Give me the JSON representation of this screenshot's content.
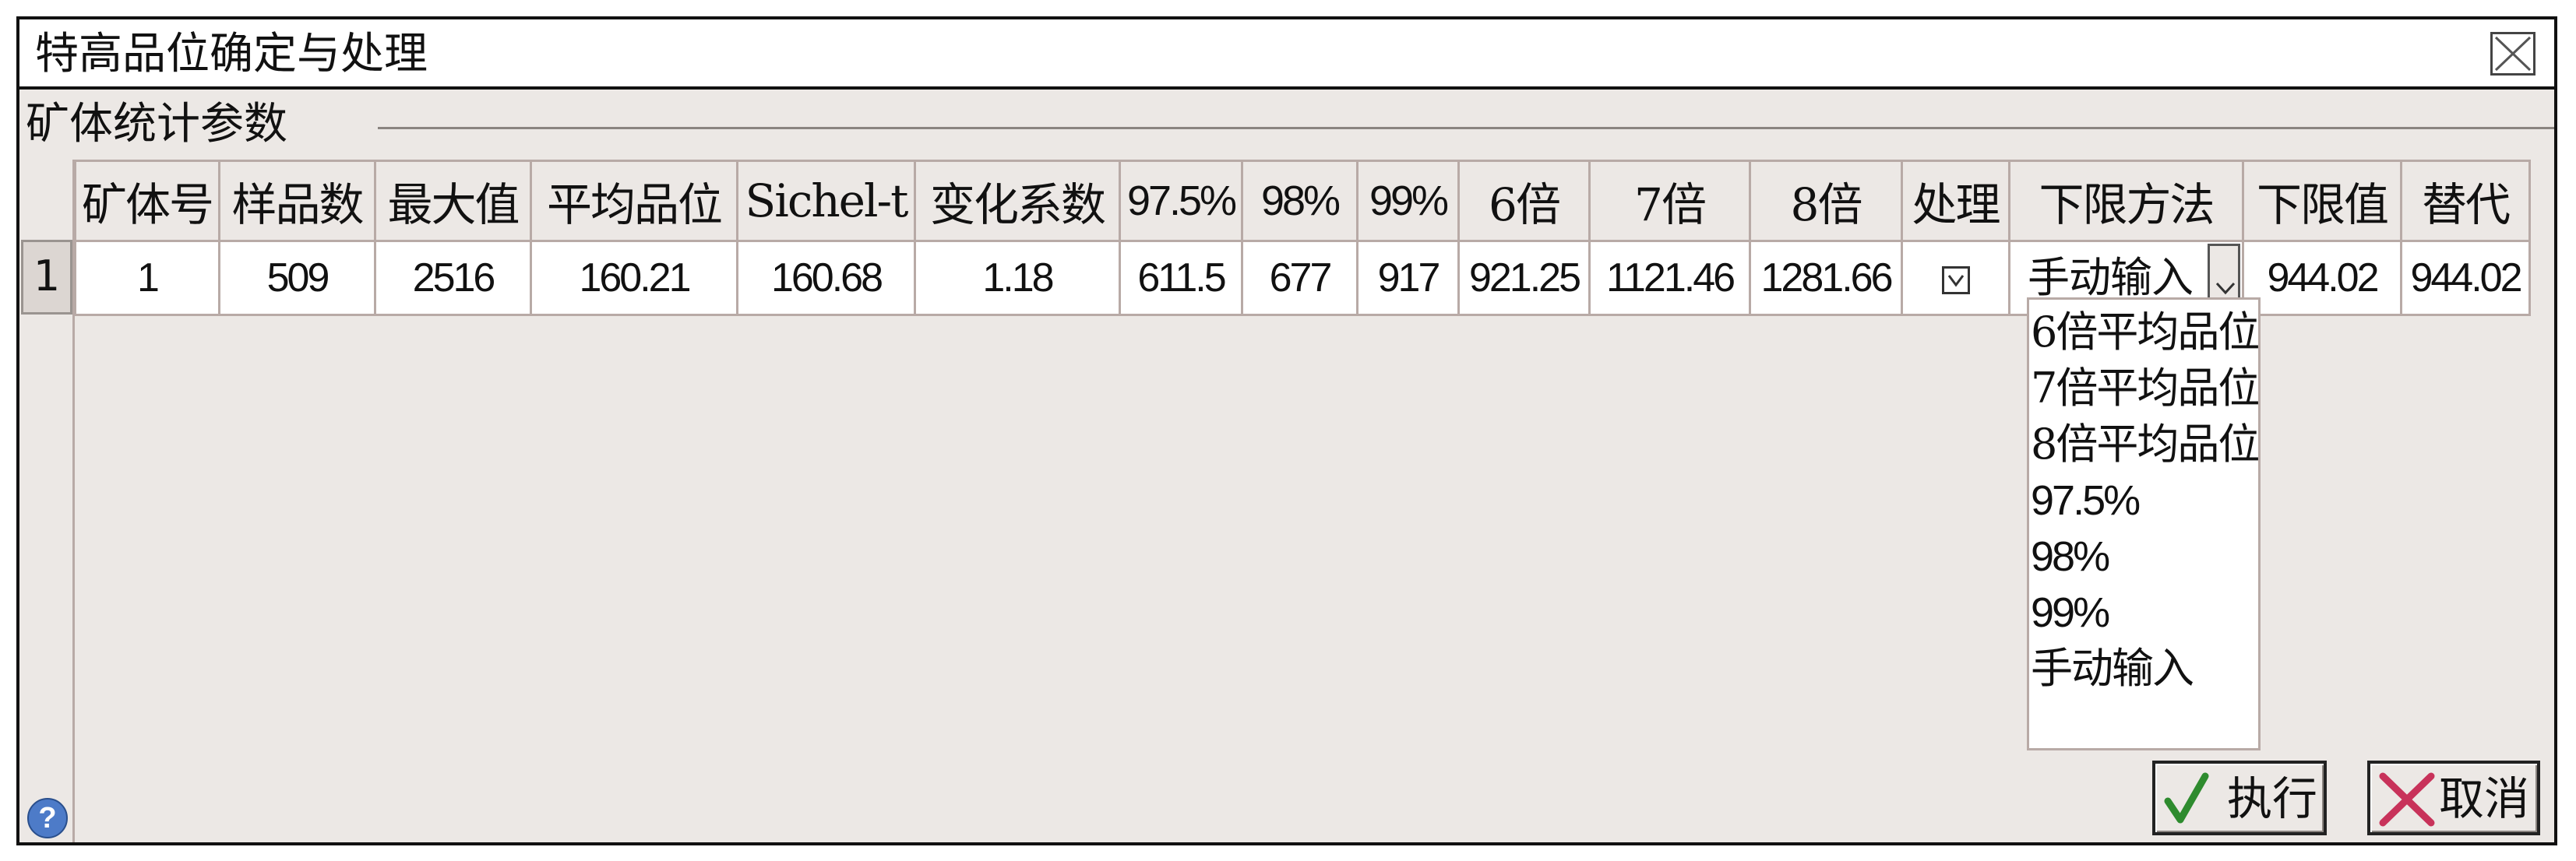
{
  "window": {
    "title": "特高品位确定与处理"
  },
  "group": {
    "title": "矿体统计参数"
  },
  "table": {
    "columns": [
      "矿体号",
      "样品数",
      "最大值",
      "平均品位",
      "Sichel-t",
      "变化系数",
      "97.5%",
      "98%",
      "99%",
      "6倍",
      "7倍",
      "8倍",
      "处理",
      "下限方法",
      "下限值",
      "替代"
    ],
    "rows": [
      {
        "row_number": "1",
        "cells": [
          "1",
          "509",
          "2516",
          "160.21",
          "160.68",
          "1.18",
          "611.5",
          "677",
          "917",
          "921.25",
          "1121.46",
          "1281.66"
        ],
        "processed": true,
        "method": "手动输入",
        "lower_limit": "944.02",
        "replacement": "944.02"
      }
    ]
  },
  "dropdown": {
    "options": [
      "6倍平均品位",
      "7倍平均品位",
      "8倍平均品位",
      "97.5%",
      "98%",
      "99%",
      "手动输入"
    ]
  },
  "buttons": {
    "execute": "执行",
    "cancel": "取消"
  },
  "icons": {
    "help": "?"
  },
  "colors": {
    "check_green": "#2e8b2e",
    "cancel_red": "#c8325a",
    "help_blue": "#4d7bc8"
  }
}
